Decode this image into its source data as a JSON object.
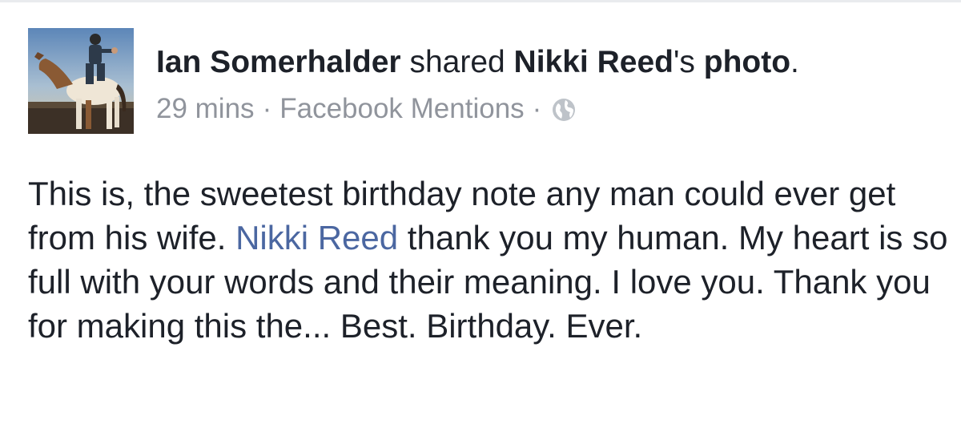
{
  "post": {
    "author": "Ian Somerhalder",
    "action_verb": "shared",
    "shared_from": "Nikki Reed",
    "possessive_suffix": "'s",
    "shared_object": "photo",
    "end_period": ".",
    "timestamp": "29 mins",
    "separator": "·",
    "source": "Facebook Mentions",
    "privacy_icon": "globe-icon",
    "body": {
      "part1": "This is, the sweetest birthday note any man could ever get from his wife. ",
      "mention": "Nikki Reed",
      "part2": " thank you my human. My heart is so full with your words and their meaning. I love you. Thank you for making this the... Best. Birthday. Ever."
    }
  },
  "colors": {
    "text": "#1d2129",
    "meta": "#90949c",
    "mention_link": "#4b67a1"
  }
}
